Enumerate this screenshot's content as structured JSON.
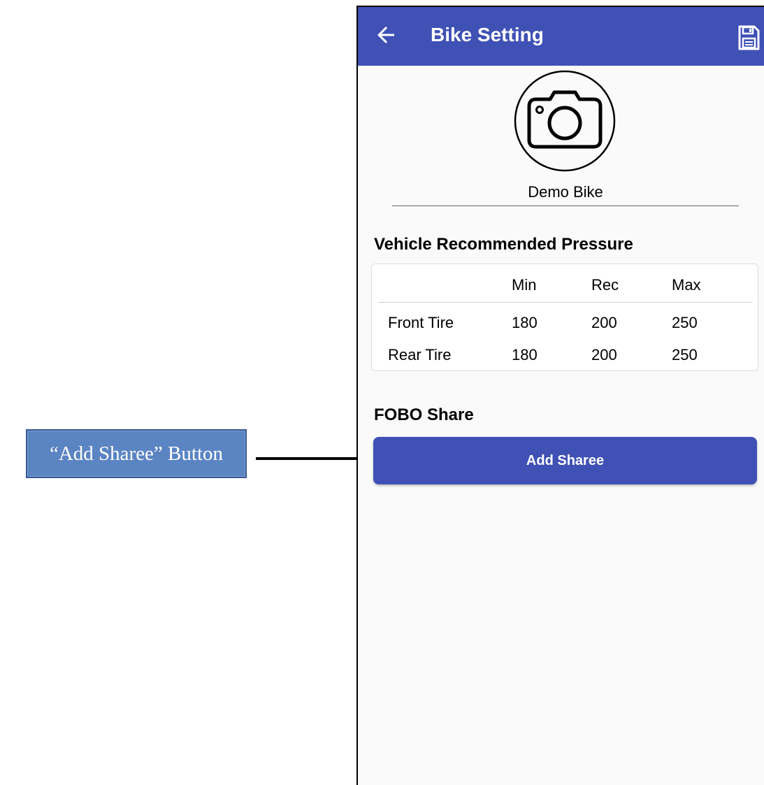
{
  "annotation": {
    "callout_text": "“Add Sharee” Button",
    "callout_color": "#5b84c2"
  },
  "app_bar": {
    "title": "Bike Setting",
    "back_icon": "arrow-back-icon",
    "save_icon": "floppy-disk-icon",
    "color": "#3f51b5"
  },
  "bike": {
    "photo_icon": "camera-icon",
    "name": "Demo Bike"
  },
  "pressure": {
    "title": "Vehicle Recommended Pressure",
    "columns": [
      "",
      "Min",
      "Rec",
      "Max"
    ],
    "rows": [
      {
        "label": "Front Tire",
        "min": "180",
        "rec": "200",
        "max": "250"
      },
      {
        "label": "Rear Tire",
        "min": "180",
        "rec": "200",
        "max": "250"
      }
    ]
  },
  "share": {
    "title": "FOBO Share",
    "button_label": "Add Sharee"
  }
}
